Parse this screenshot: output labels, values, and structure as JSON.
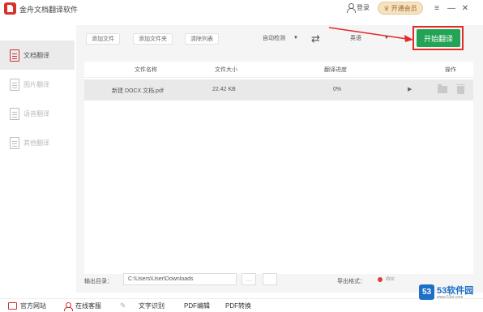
{
  "app": {
    "title": "金舟文档翻译软件"
  },
  "titlebar": {
    "login_label": "登录",
    "vip_label": "开通会员",
    "vip_icon": "crown-icon"
  },
  "window_controls": {
    "menu": "≡",
    "minimize": "—",
    "close": "✕"
  },
  "sidebar": {
    "items": [
      {
        "label": "文档翻译",
        "icon": "document-icon",
        "active": true
      },
      {
        "label": "图片翻译",
        "icon": "image-icon",
        "active": false
      },
      {
        "label": "语音翻译",
        "icon": "voice-icon",
        "active": false
      },
      {
        "label": "其他翻译",
        "icon": "other-icon",
        "active": false
      }
    ]
  },
  "toolbar": {
    "add_file": "添加文件",
    "add_folder": "添加文件夹",
    "clear_list": "清除列表",
    "source_lang": "自动检测",
    "target_lang": "英语",
    "start_label": "开始翻译"
  },
  "table": {
    "headers": {
      "name": "文件名称",
      "size": "文件大小",
      "progress": "翻译进度",
      "actions": "操作"
    },
    "rows": [
      {
        "name": "新建 DOCX 文档.pdf",
        "size": "22.42 KB",
        "progress": "0%"
      }
    ]
  },
  "output": {
    "label": "输出目录：",
    "path": "C:\\Users\\User\\Downloads",
    "format_label": "导出格式：",
    "format_value": "doc"
  },
  "bottombar": {
    "items": [
      {
        "label": "官方网站",
        "icon": "monitor-icon"
      },
      {
        "label": "在线客服",
        "icon": "person-icon"
      },
      {
        "label": "文字识别",
        "icon": "pen-icon"
      },
      {
        "label": "PDF编辑",
        "icon": "none"
      },
      {
        "label": "PDF转换",
        "icon": "none"
      }
    ]
  },
  "watermark": {
    "badge": "53",
    "text": "53软件园",
    "url": "www.53xt.com"
  },
  "colors": {
    "accent_green": "#23a356",
    "highlight_red": "#e52a2a",
    "brand_red": "#d6322b",
    "watermark_blue": "#1e6fc7"
  }
}
